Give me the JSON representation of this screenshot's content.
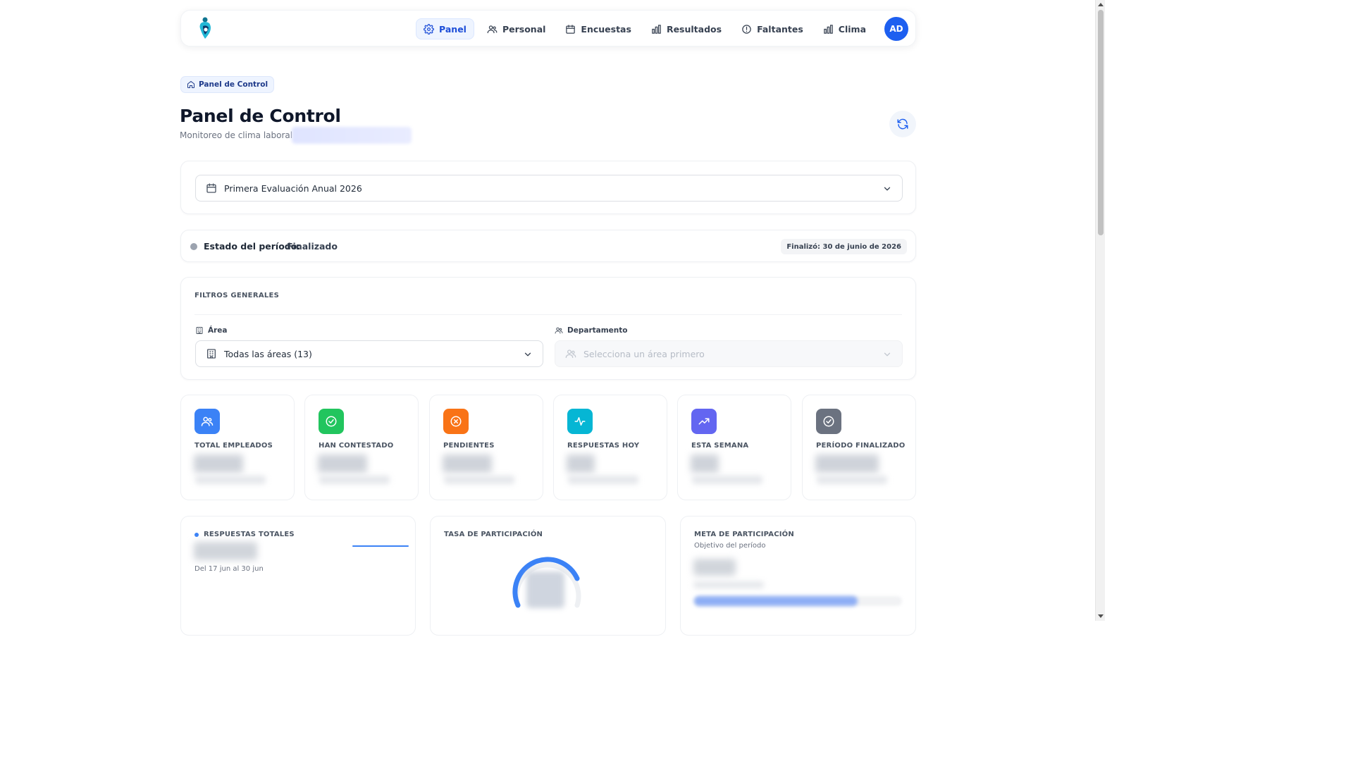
{
  "nav": {
    "items": [
      {
        "label": "Panel",
        "icon": "gear-icon",
        "active": true
      },
      {
        "label": "Personal",
        "icon": "users-icon",
        "active": false
      },
      {
        "label": "Encuestas",
        "icon": "calendar-icon",
        "active": false
      },
      {
        "label": "Resultados",
        "icon": "bar-chart-icon",
        "active": false
      },
      {
        "label": "Faltantes",
        "icon": "alert-circle-icon",
        "active": false
      },
      {
        "label": "Clima",
        "icon": "bar-chart-icon",
        "active": false
      }
    ],
    "avatar_initials": "AD"
  },
  "breadcrumb": {
    "label": "Panel de Control"
  },
  "header": {
    "title": "Panel de Control",
    "subtitle": "Monitoreo de clima laboral"
  },
  "period": {
    "selected": "Primera Evaluación Anual 2026"
  },
  "status": {
    "label": "Estado del período:",
    "value": "Finalizado",
    "badge": "Finalizó: 30 de junio de 2026"
  },
  "filters": {
    "title": "FILTROS GENERALES",
    "area_label": "Área",
    "area_value": "Todas las áreas (13)",
    "department_label": "Departamento",
    "department_placeholder": "Selecciona un área primero"
  },
  "stats": [
    {
      "label": "TOTAL EMPLEADOS",
      "color": "#3b82f6",
      "icon": "users-icon"
    },
    {
      "label": "HAN CONTESTADO",
      "color": "#22c55e",
      "icon": "check-circle-icon"
    },
    {
      "label": "PENDIENTES",
      "color": "#f97316",
      "icon": "x-circle-icon"
    },
    {
      "label": "RESPUESTAS HOY",
      "color": "#06b6d4",
      "icon": "activity-icon"
    },
    {
      "label": "ESTA SEMANA",
      "color": "#6366f1",
      "icon": "trending-up-icon"
    },
    {
      "label": "PERÍODO FINALIZADO",
      "color": "#6b7280",
      "icon": "check-circle-icon"
    }
  ],
  "responses": {
    "title": "RESPUESTAS TOTALES",
    "range": "Del 17 jun al 30 jun"
  },
  "participation": {
    "title": "TASA DE PARTICIPACIÓN"
  },
  "goal": {
    "title": "META DE PARTICIPACIÓN",
    "subtitle": "Objetivo del período"
  },
  "colors": {
    "accent": "#1d5ff0",
    "active_nav_bg": "#eef4ff"
  }
}
